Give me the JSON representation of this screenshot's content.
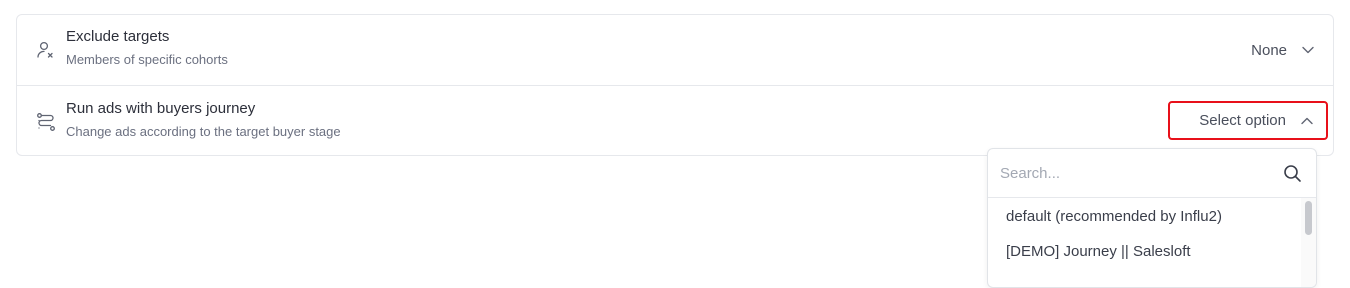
{
  "rows": [
    {
      "title": "Exclude targets",
      "subtitle": "Members of specific cohorts",
      "value": "None",
      "icon": "user-x-icon"
    },
    {
      "title": "Run ads with buyers journey",
      "subtitle": "Change ads according to the target buyer stage",
      "value": "Select option",
      "icon": "journey-route-icon"
    }
  ],
  "dropdown": {
    "search_placeholder": "Search...",
    "search_value": "",
    "options": [
      "default (recommended by Influ2)",
      "[DEMO] Journey || Salesloft"
    ]
  },
  "colors": {
    "highlight_border": "#e8101a",
    "text_primary": "#2c2f3a",
    "text_secondary": "#6b7080",
    "border": "#e6e8ec"
  }
}
